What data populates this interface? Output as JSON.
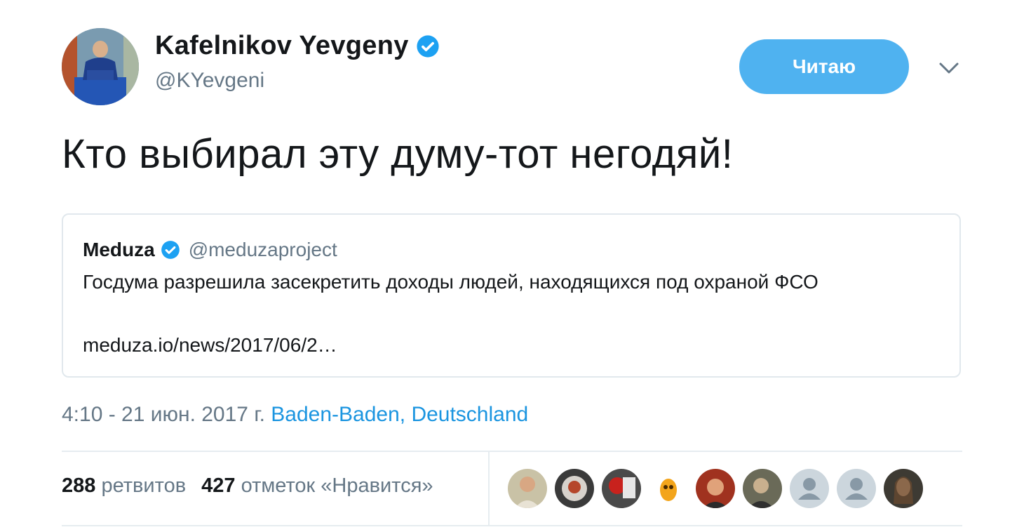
{
  "author": {
    "name": "Kafelnikov Yevgeny",
    "handle": "@KYevgeni",
    "verified": true
  },
  "follow_button": {
    "label": "Читаю"
  },
  "tweet": {
    "text": "Кто выбирал эту думу-тот негодяй!"
  },
  "quote": {
    "name": "Meduza",
    "handle": "@meduzaproject",
    "text": "Госдума разрешила засекретить доходы людей, находящихся под охраной ФСО",
    "link": "meduza.io/news/2017/06/2…"
  },
  "meta": {
    "time": "4:10 - 21 июн. 2017 г.",
    "location": "Baden-Baden, Deutschland"
  },
  "stats": {
    "retweets_count": "288",
    "retweets_label": "ретвитов",
    "likes_count": "427",
    "likes_label": "отметок «Нравится»"
  },
  "colors": {
    "accent": "#1b95e0",
    "follow_button": "#4fb2f0",
    "secondary_text": "#657786",
    "border": "#e1e8ed"
  },
  "likers": [
    "avatar",
    "avatar",
    "avatar",
    "avatar",
    "avatar",
    "avatar",
    "default-avatar",
    "default-avatar",
    "avatar"
  ]
}
